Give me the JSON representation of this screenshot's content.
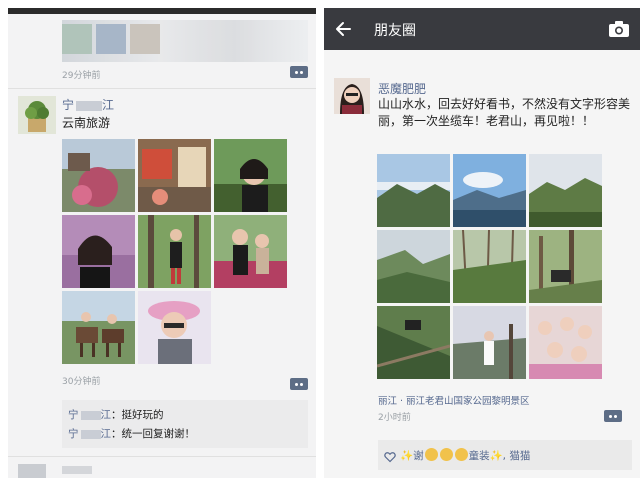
{
  "left": {
    "previous_post_time": "29分钟前",
    "post": {
      "author_visible": "宁",
      "author_suffix": "江",
      "text": "云南旅游",
      "time": "30分钟前"
    },
    "comments": [
      {
        "name": "宁",
        "suffix": "江",
        "text": "：挺好玩的"
      },
      {
        "name": "宁",
        "suffix": "江",
        "text": "：统一回复谢谢！"
      }
    ]
  },
  "right": {
    "nav": {
      "title": "朋友圈",
      "back_icon": "arrow-left-icon",
      "camera_icon": "camera-icon"
    },
    "post": {
      "author": "恶魔肥肥",
      "text": "山山水水，回去好好看书，不然没有文字形容美丽，第一次坐缆车！老君山，再见啦！！",
      "location": "丽江 · 丽江老君山国家公园黎明景区",
      "time": "2小时前"
    },
    "likes": {
      "prefix": "✨谢",
      "middle": "童装✨",
      "separator": ", ",
      "second": "猫猫"
    }
  },
  "colors": {
    "nav_bar": "#393a3f",
    "name_link": "#56698f",
    "panel_bg": "#f3f3f4",
    "comment_bg": "#ebebec"
  }
}
